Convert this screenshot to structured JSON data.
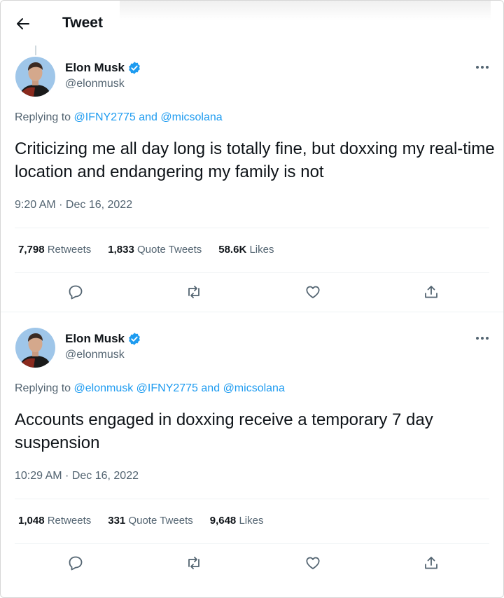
{
  "header": {
    "title": "Tweet",
    "back_icon": "arrow-left-icon"
  },
  "colors": {
    "link": "#1d9bf0",
    "verified": "#1d9bf0",
    "secondary_text": "#536471",
    "primary_text": "#0f1419"
  },
  "tweets": [
    {
      "author": {
        "name": "Elon Musk",
        "handle": "@elonmusk"
      },
      "replying": {
        "prefix": "Replying to",
        "user1": "@IFNY2775",
        "joiner": "and",
        "user2": "@micsolana"
      },
      "text": "Criticizing me all day long is totally fine, but doxxing my real-time location and endangering my family is not",
      "timestamp": "9:20 AM · Dec 16, 2022",
      "stats": {
        "retweets": "7,798",
        "retweets_label": "Retweets",
        "quotes": "1,833",
        "quotes_label": "Quote Tweets",
        "likes": "58.6K",
        "likes_label": "Likes"
      }
    },
    {
      "author": {
        "name": "Elon Musk",
        "handle": "@elonmusk"
      },
      "replying": {
        "prefix": "Replying to",
        "user0": "@elonmusk",
        "user1": "@IFNY2775",
        "joiner": "and",
        "user2": "@micsolana"
      },
      "text": "Accounts engaged in doxxing receive a temporary 7 day suspension",
      "timestamp": "10:29 AM · Dec 16, 2022",
      "stats": {
        "retweets": "1,048",
        "retweets_label": "Retweets",
        "quotes": "331",
        "quotes_label": "Quote Tweets",
        "likes": "9,648",
        "likes_label": "Likes"
      }
    }
  ],
  "actions": [
    "reply-icon",
    "retweet-icon",
    "like-icon",
    "share-icon"
  ]
}
